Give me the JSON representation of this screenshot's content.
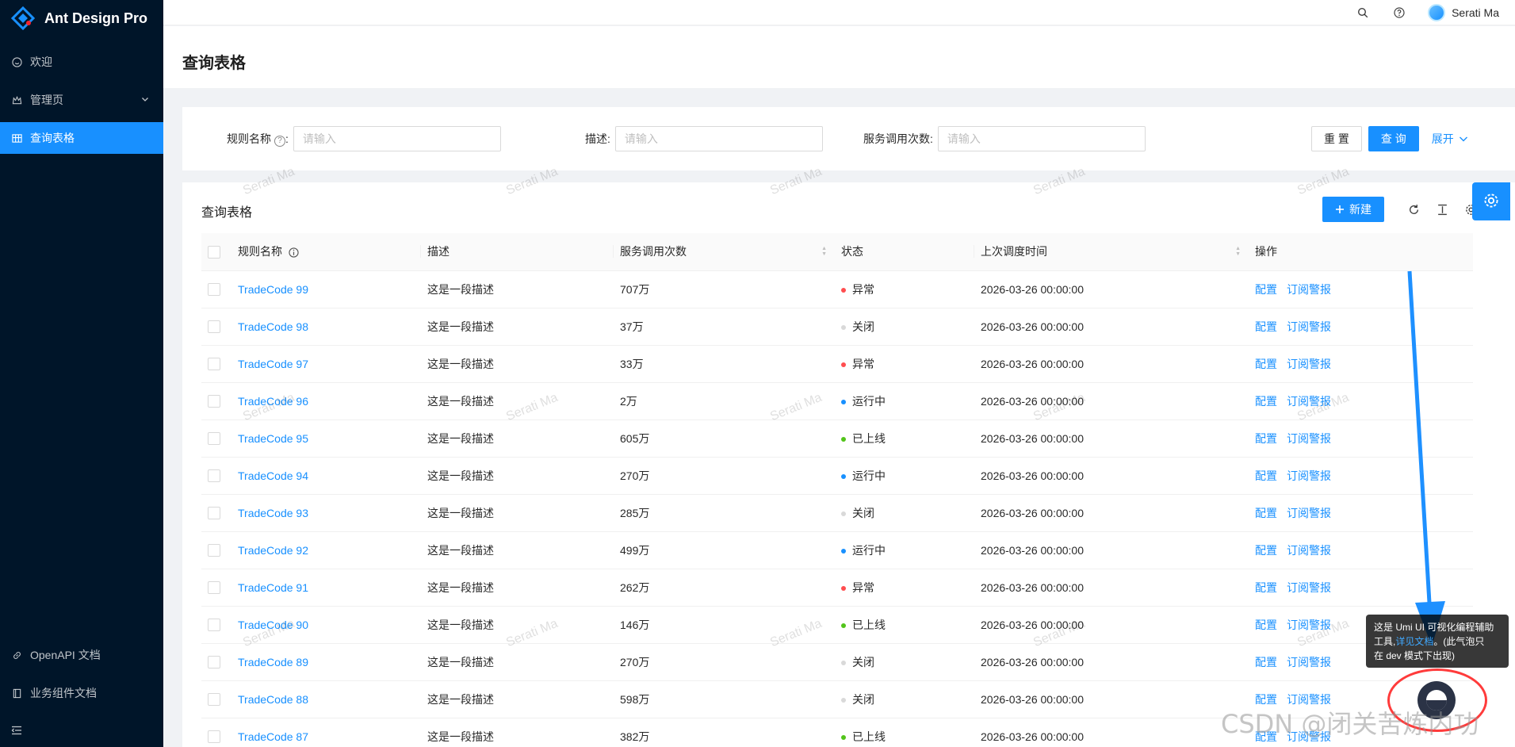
{
  "app": {
    "title": "Ant Design Pro"
  },
  "sidebar": {
    "items": [
      {
        "label": "欢迎",
        "icon": "smile-icon"
      },
      {
        "label": "管理页",
        "icon": "crown-icon"
      },
      {
        "label": "查询表格",
        "icon": "table-icon",
        "active": true
      }
    ],
    "bottom_items": [
      {
        "label": "OpenAPI 文档",
        "icon": "link-icon"
      },
      {
        "label": "业务组件文档",
        "icon": "book-icon"
      }
    ]
  },
  "header": {
    "user_name": "Serati Ma"
  },
  "page": {
    "title": "查询表格"
  },
  "search": {
    "fields": [
      {
        "label": "规则名称",
        "placeholder": "请输入"
      },
      {
        "label": "描述:",
        "placeholder": "请输入"
      },
      {
        "label": "服务调用次数:",
        "placeholder": "请输入"
      }
    ],
    "reset_label": "重 置",
    "query_label": "查 询",
    "expand_label": "展开"
  },
  "table": {
    "title": "查询表格",
    "new_label": "新建",
    "columns": [
      "规则名称",
      "描述",
      "服务调用次数",
      "状态",
      "上次调度时间",
      "操作"
    ],
    "action_config": "配置",
    "action_subscribe": "订阅警报",
    "rows": [
      {
        "name": "TradeCode 99",
        "desc": "这是一段描述",
        "calls": "707万",
        "status": "异常",
        "status_color": "#ff4d4f",
        "time": "2026-03-26 00:00:00"
      },
      {
        "name": "TradeCode 98",
        "desc": "这是一段描述",
        "calls": "37万",
        "status": "关闭",
        "status_color": "#d9d9d9",
        "time": "2026-03-26 00:00:00"
      },
      {
        "name": "TradeCode 97",
        "desc": "这是一段描述",
        "calls": "33万",
        "status": "异常",
        "status_color": "#ff4d4f",
        "time": "2026-03-26 00:00:00"
      },
      {
        "name": "TradeCode 96",
        "desc": "这是一段描述",
        "calls": "2万",
        "status": "运行中",
        "status_color": "#1890ff",
        "time": "2026-03-26 00:00:00"
      },
      {
        "name": "TradeCode 95",
        "desc": "这是一段描述",
        "calls": "605万",
        "status": "已上线",
        "status_color": "#52c41a",
        "time": "2026-03-26 00:00:00"
      },
      {
        "name": "TradeCode 94",
        "desc": "这是一段描述",
        "calls": "270万",
        "status": "运行中",
        "status_color": "#1890ff",
        "time": "2026-03-26 00:00:00"
      },
      {
        "name": "TradeCode 93",
        "desc": "这是一段描述",
        "calls": "285万",
        "status": "关闭",
        "status_color": "#d9d9d9",
        "time": "2026-03-26 00:00:00"
      },
      {
        "name": "TradeCode 92",
        "desc": "这是一段描述",
        "calls": "499万",
        "status": "运行中",
        "status_color": "#1890ff",
        "time": "2026-03-26 00:00:00"
      },
      {
        "name": "TradeCode 91",
        "desc": "这是一段描述",
        "calls": "262万",
        "status": "异常",
        "status_color": "#ff4d4f",
        "time": "2026-03-26 00:00:00"
      },
      {
        "name": "TradeCode 90",
        "desc": "这是一段描述",
        "calls": "146万",
        "status": "已上线",
        "status_color": "#52c41a",
        "time": "2026-03-26 00:00:00"
      },
      {
        "name": "TradeCode 89",
        "desc": "这是一段描述",
        "calls": "270万",
        "status": "关闭",
        "status_color": "#d9d9d9",
        "time": "2026-03-26 00:00:00"
      },
      {
        "name": "TradeCode 88",
        "desc": "这是一段描述",
        "calls": "598万",
        "status": "关闭",
        "status_color": "#d9d9d9",
        "time": "2026-03-26 00:00:00"
      },
      {
        "name": "TradeCode 87",
        "desc": "这是一段描述",
        "calls": "382万",
        "status": "已上线",
        "status_color": "#52c41a",
        "time": "2026-03-26 00:00:00"
      }
    ]
  },
  "watermark": {
    "text": "Serati Ma"
  },
  "tooltip": {
    "line1": "这是 Umi UI 可视化编程辅助",
    "line2_prefix": "工具,",
    "link": "详见文档",
    "line2_suffix": "。(此气泡只",
    "line3": "在 dev 模式下出现)"
  },
  "overlay": {
    "csdn_watermark": "CSDN @闭关苦炼内功"
  },
  "colors": {
    "primary": "#1890ff",
    "sider_bg": "#001529",
    "annotation_red": "#ff3b3b",
    "annotation_arrow": "#1e90ff"
  }
}
